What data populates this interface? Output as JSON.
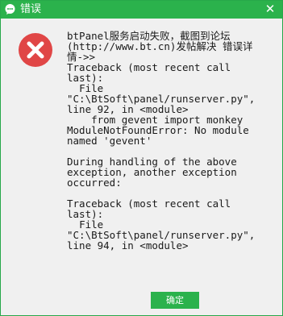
{
  "window": {
    "title": "错误",
    "close_glyph": "✕"
  },
  "dialog": {
    "icon": "error-x-icon",
    "message": "btPanel服务启动失败，截图到论坛\n(http://www.bt.cn)发帖解决 错误详\n情->>\nTraceback (most recent call last):\n  File\n\"C:\\BtSoft\\panel/runserver.py\",\nline 92, in <module>\n    from gevent import monkey\nModuleNotFoundError: No module\nnamed 'gevent'\n\nDuring handling of the above\nexception, another exception\noccurred:\n\nTraceback (most recent call last):\n  File\n\"C:\\BtSoft\\panel/runserver.py\",\nline 94, in <module>"
  },
  "buttons": {
    "ok_label": "确定"
  },
  "colors": {
    "accent": "#2bb24c",
    "error": "#e04646"
  }
}
